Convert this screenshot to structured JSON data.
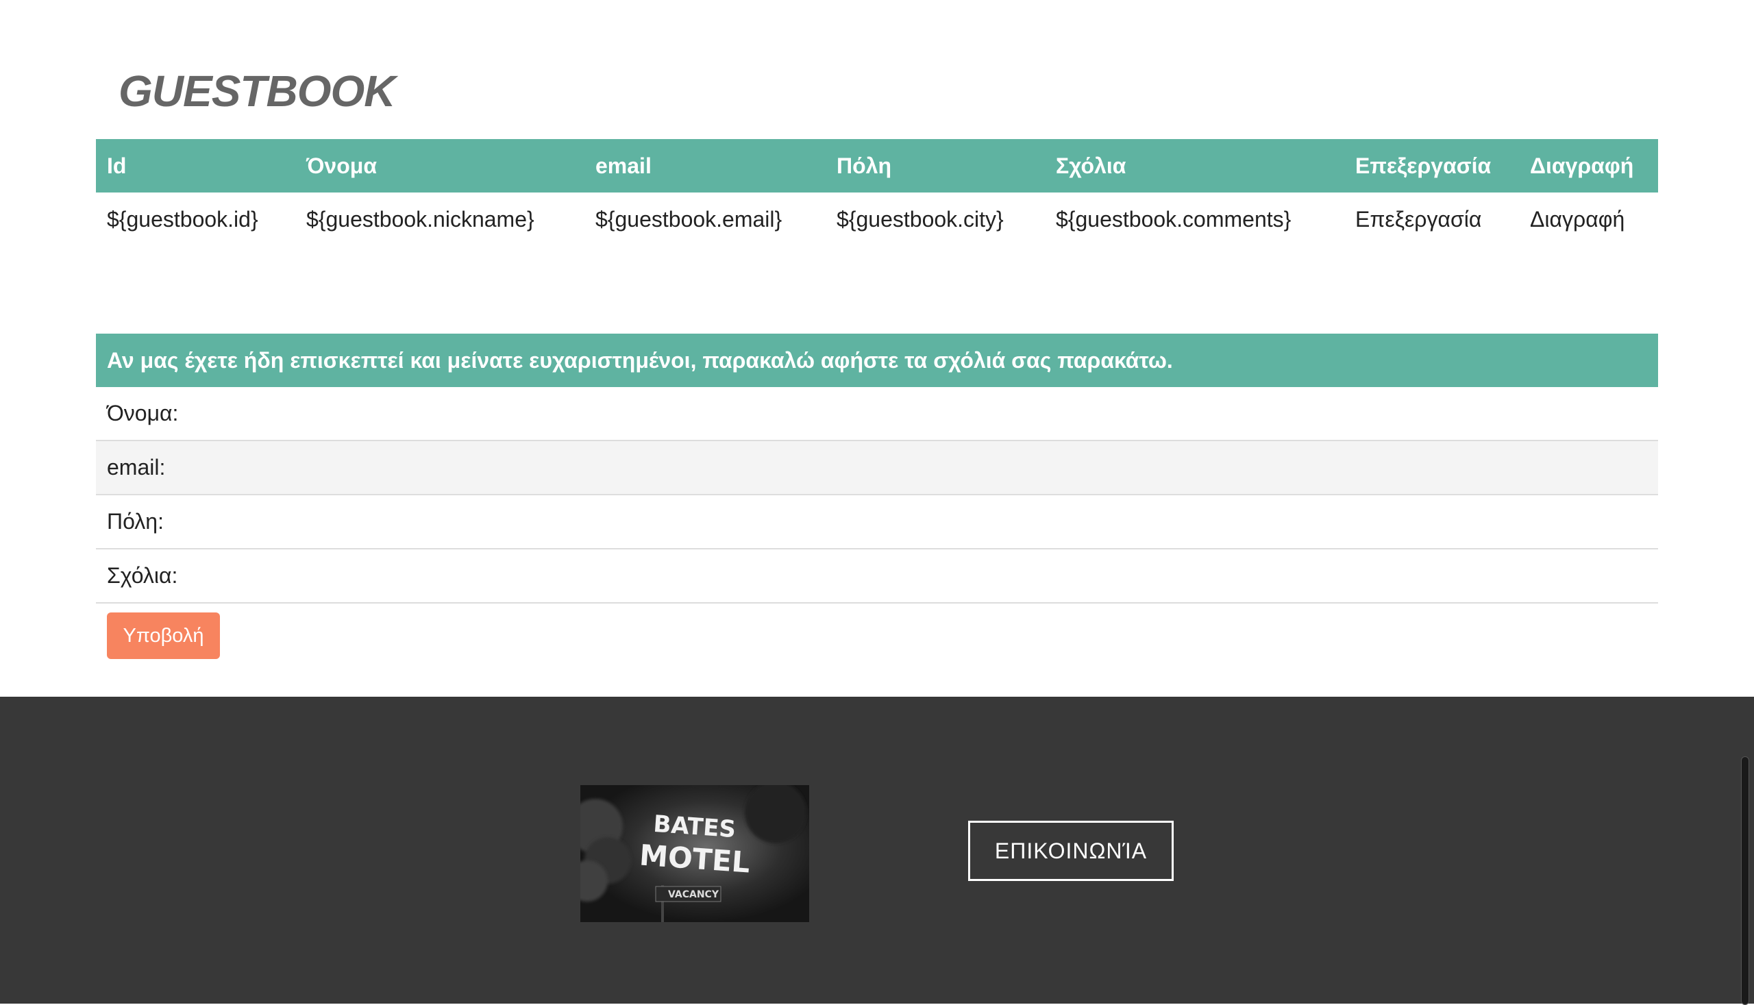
{
  "title": "GUESTBOOK",
  "table": {
    "headers": [
      "Id",
      "Όνομα",
      "email",
      "Πόλη",
      "Σχόλια",
      "Επεξεργασία",
      "Διαγραφή"
    ],
    "rows": [
      [
        "${guestbook.id}",
        "${guestbook.nickname}",
        "${guestbook.email}",
        "${guestbook.city}",
        "${guestbook.comments}",
        "Επεξεργασία",
        "Διαγραφή"
      ]
    ]
  },
  "form": {
    "header": "Αν μας έχετε ήδη επισκεπτεί και μείνατε ευχαριστημένοι, παρακαλώ αφήστε τα σχόλιά σας παρακάτω.",
    "fields": [
      "Όνομα:",
      "email:",
      "Πόλη:",
      "Σχόλια:"
    ],
    "submit_label": "Υποβολή"
  },
  "footer": {
    "image_text_line1": "BATES",
    "image_text_line2": "MOTEL",
    "image_text_line3": "VACANCY",
    "contact_label": "ΕΠΙΚΟΙΝΩΝΊΑ"
  },
  "colors": {
    "accent": "#5fb3a1",
    "submit": "#f7845f",
    "footer_bg": "#383838"
  }
}
